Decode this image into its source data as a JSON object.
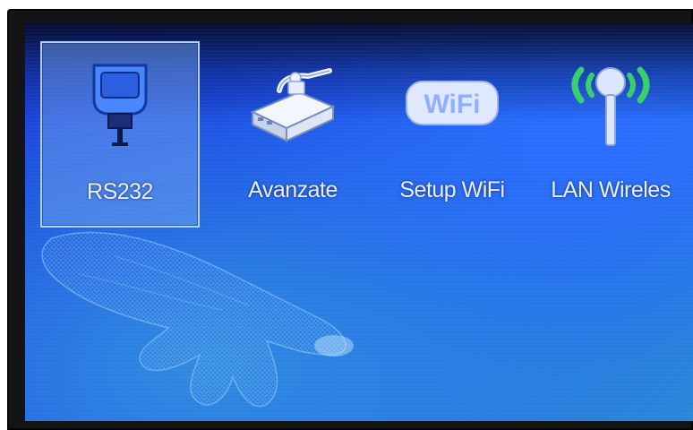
{
  "menu": {
    "items": [
      {
        "label": "RS232",
        "icon": "serial-port-icon",
        "selected": true
      },
      {
        "label": "Avanzate",
        "icon": "router-device-icon",
        "selected": false
      },
      {
        "label": "Setup WiFi",
        "icon": "wifi-badge-icon",
        "selected": false
      },
      {
        "label": "LAN Wireles",
        "icon": "wireless-antenna-icon",
        "selected": false
      }
    ]
  },
  "wifi_badge_text": "WiFi",
  "colors": {
    "screen_blue": "#1c52e6",
    "selection_fill": "#78aaf0",
    "label_text": "#e8eefc",
    "bezel": "#141416"
  }
}
